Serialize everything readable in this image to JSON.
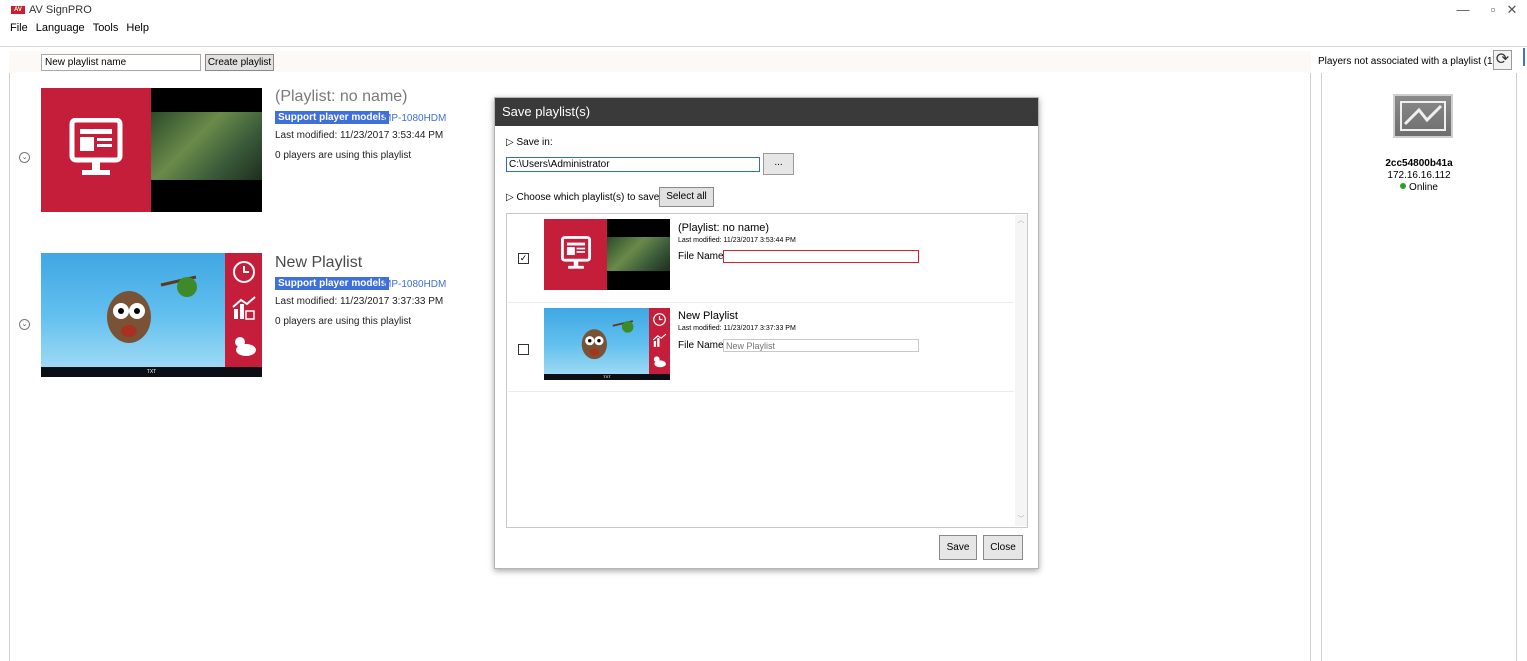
{
  "window": {
    "title": "AV SignPRO",
    "logo_text": "AV",
    "minimize": "—",
    "maximize": "▫",
    "close": "✕"
  },
  "menu": [
    "File",
    "Language",
    "Tools",
    "Help"
  ],
  "toolbar": {
    "playlist_name_value": "New playlist name",
    "create_label": "Create playlist"
  },
  "playlists": [
    {
      "title": "(Playlist: no name)",
      "badge": "Support player models",
      "model": "MP-1080HDM",
      "modified": "Last modified: 11/23/2017 3:53:44 PM",
      "players": "0 players are using this playlist"
    },
    {
      "title": "New Playlist",
      "badge": "Support player models",
      "model": "MP-1080HDM",
      "modified": "Last modified: 11/23/2017 3:37:33 PM",
      "players": "0 players are using this playlist",
      "ticker": "TXT"
    }
  ],
  "right_panel": {
    "header": "Players not associated with a playlist (1)",
    "player": {
      "name": "2cc54800b41a",
      "ip": "172.16.16.112",
      "status": "Online"
    }
  },
  "dialog": {
    "title": "Save playlist(s)",
    "save_in_label": "Save in:",
    "path_value": "C:\\Users\\Administrator",
    "browse_label": "...",
    "choose_label": "Choose which playlist(s) to save:",
    "select_all_label": "Select all",
    "items": [
      {
        "title": "(Playlist: no name)",
        "modified": "Last modified: 11/23/2017 3:53:44 PM",
        "file_name_label": "File Name",
        "file_name_value": "",
        "file_name_placeholder": "",
        "checked": true,
        "check_mark": "✓"
      },
      {
        "title": "New Playlist",
        "modified": "Last modified: 11/23/2017 3:37:33 PM",
        "file_name_label": "File Name",
        "file_name_value": "",
        "file_name_placeholder": "New Playlist",
        "checked": false,
        "check_mark": ""
      }
    ],
    "save_label": "Save",
    "close_label": "Close"
  },
  "colors": {
    "accent": "#3f6fd8",
    "brand_red": "#c41e3a",
    "dialog_header": "#3a3a3a",
    "error_border": "#d9232d",
    "online": "#22a032"
  }
}
